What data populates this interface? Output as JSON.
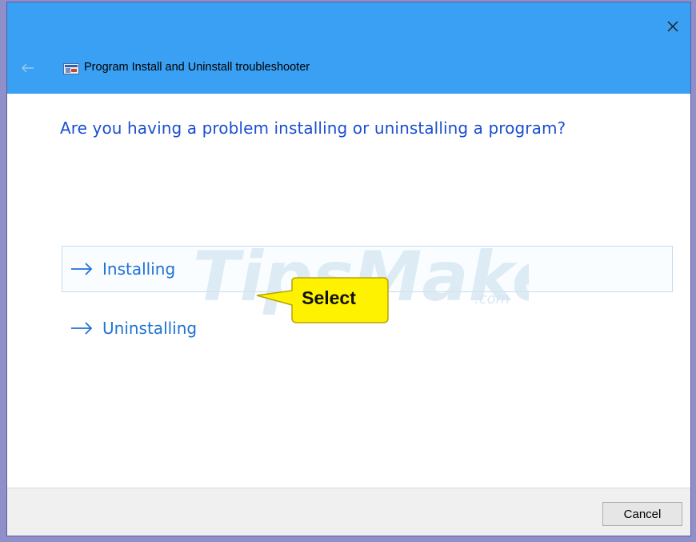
{
  "window": {
    "title": "Program Install and Uninstall troubleshooter",
    "accent_color": "#3aa0f3",
    "close_icon": "close-icon",
    "back_icon": "back-arrow-icon"
  },
  "main": {
    "question": "Are you having a problem installing or uninstalling a program?",
    "options": [
      {
        "label": "Installing",
        "icon": "arrow-right-icon",
        "highlighted": true
      },
      {
        "label": "Uninstalling",
        "icon": "arrow-right-icon",
        "highlighted": false
      }
    ]
  },
  "annotation": {
    "callout_text": "Select",
    "callout_color": "#fff200"
  },
  "watermark": {
    "main": "TipsMake",
    "suffix": ".com"
  },
  "footer": {
    "cancel_label": "Cancel"
  }
}
